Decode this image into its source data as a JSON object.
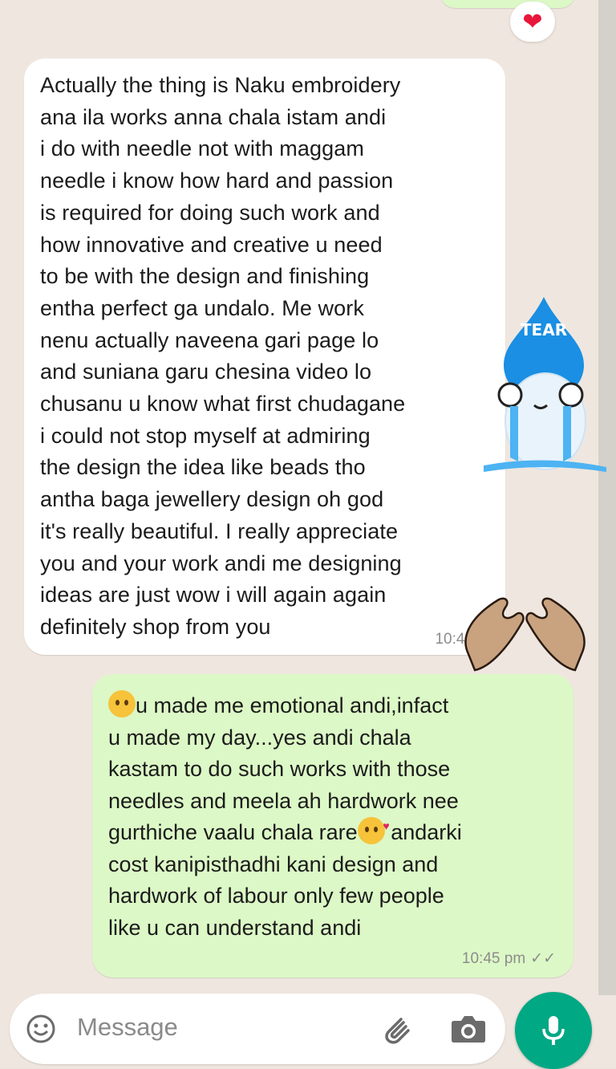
{
  "chat": {
    "reaction": {
      "heart": "❤"
    },
    "incoming": {
      "text": "Actually the thing is Naku embroidery\nana ila works anna chala istam andi\ni do with needle not with maggam\nneedle i know how hard and passion\nis required for doing such work and\nhow innovative and creative u need\nto be with the design and finishing\nentha perfect ga undalo. Me work\nnenu actually naveena gari page lo\nand suniana garu chesina video lo\nchusanu u know what first chudagane\ni could not stop myself at admiring\nthe design the idea like beads tho\nantha baga jewellery design oh god\nit's really beautiful. I really appreciate\nyou and your work andi me designing\nideas are just wow i will again again\ndefinitely shop from you",
      "time": "10:42"
    },
    "outgoing": {
      "line1": "u made me emotional andi,infact",
      "line2": "u made my day...yes andi chala",
      "line3": "kastam to do such works with those",
      "line4": "needles and meela ah hardwork nee",
      "line5a": "gurthiche vaalu chala rare",
      "line5b": " andarki",
      "line6": "cost kanipisthadhi kani design and",
      "line7": "hardwork of labour only few people",
      "line8": "like u can understand andi",
      "time": "10:45 pm",
      "ticks": "✓✓"
    },
    "stickers": {
      "tear_label": "TEAR"
    }
  },
  "composer": {
    "placeholder": "Message",
    "icons": [
      "emoji-icon",
      "attach-icon",
      "camera-icon",
      "mic-icon"
    ]
  },
  "colors": {
    "incoming_bubble": "#ffffff",
    "outgoing_bubble": "#dcf8c6",
    "chat_background": "#efe7df",
    "accent": "#00a884"
  }
}
